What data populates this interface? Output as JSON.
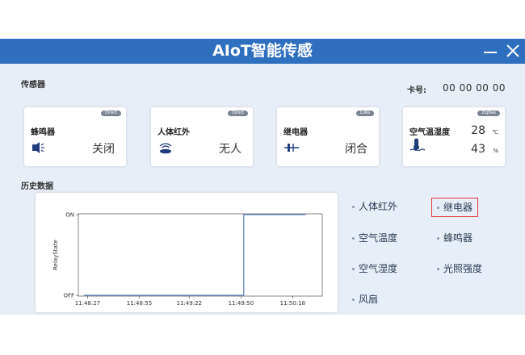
{
  "window": {
    "title": "AIoT智能传感"
  },
  "sensors": {
    "section_label": "传感器",
    "card_number_label": "卡号:",
    "card_number": "00 00 00 00",
    "cards": [
      {
        "name": "蜂鸣器",
        "badge": "Direct",
        "value": "关闭",
        "icon": "buzzer-icon"
      },
      {
        "name": "人体红外",
        "badge": "Direct",
        "value": "无人",
        "icon": "infrared-icon"
      },
      {
        "name": "继电器",
        "badge": "LoRa",
        "value": "闭合",
        "icon": "relay-icon"
      },
      {
        "name": "空气温湿度",
        "badge": "ZigBee",
        "temperature": "28",
        "temperature_unit": "℃",
        "humidity": "43",
        "humidity_unit": "%",
        "icon": "thermometer-icon"
      }
    ]
  },
  "history": {
    "section_label": "历史数据",
    "options": [
      {
        "label": "人体红外",
        "selected": false
      },
      {
        "label": "继电器",
        "selected": true
      },
      {
        "label": "空气温度",
        "selected": false
      },
      {
        "label": "蜂鸣器",
        "selected": false
      },
      {
        "label": "空气湿度",
        "selected": false
      },
      {
        "label": "光照强度",
        "selected": false
      },
      {
        "label": "风扇",
        "selected": false
      }
    ]
  },
  "chart_data": {
    "type": "line",
    "ylabel": "RelayState",
    "y_categories": [
      "OFF",
      "ON"
    ],
    "x_ticks": [
      "11:48:27",
      "11:48:55",
      "11:49:22",
      "11:49:50",
      "11:50:18"
    ],
    "x_tick_seconds": [
      0,
      28,
      55,
      83,
      111
    ],
    "series": [
      {
        "color": "#5a7fb8",
        "points": [
          {
            "t": -2,
            "y": 0
          },
          {
            "t": 84.5,
            "y": 0
          },
          {
            "t": 84.5,
            "y": 1
          },
          {
            "t": 118,
            "y": 1
          }
        ]
      }
    ],
    "xlim": [
      -5,
      127
    ],
    "ylim": [
      0,
      1
    ],
    "grid": false
  }
}
